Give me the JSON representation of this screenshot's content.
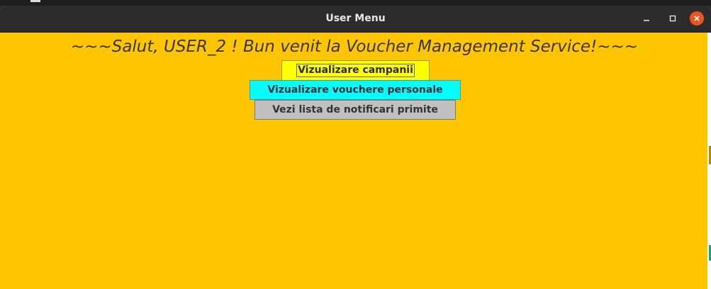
{
  "window": {
    "title": "User Menu"
  },
  "main": {
    "greeting": "~~~Salut, USER_2 ! Bun venit la Voucher Management Service!~~~",
    "buttons": [
      {
        "label": "Vizualizare campanii",
        "color": "#ffff00"
      },
      {
        "label": "Vizualizare vouchere personale",
        "color": "#00ffff"
      },
      {
        "label": "Vezi lista de notificari primite",
        "color": "#c0c0c0"
      }
    ]
  },
  "theme": {
    "background": "#ffc600",
    "titlebar": "#2c2c2c",
    "close_button": "#e9541f"
  },
  "icons": {
    "minimize": "minimize-icon",
    "maximize": "maximize-icon",
    "close": "close-icon"
  }
}
